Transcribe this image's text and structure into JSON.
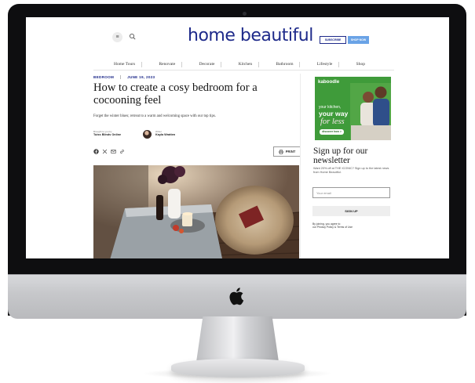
{
  "site": {
    "logo": "home beautiful",
    "menu_icon": "menu-icon",
    "search_icon": "search-icon",
    "subscribe_label": "SUBSCRIBE",
    "shop_label": "SHOP NOW",
    "nav": [
      "Home Tours",
      "Renovate",
      "Decorate",
      "Kitchen",
      "Bathroom",
      "Lifestyle",
      "Shop"
    ]
  },
  "article": {
    "category": "BEDROOM",
    "date": "JUNE 19, 2023",
    "headline": "How to create a cosy bedroom for a cocooning feel",
    "standfirst": "Forget the winter blues; retreat to a warm and welcoming space with our top tips.",
    "brought_by_label": "Brought to you by",
    "brought_by": "Tuiss Blinds Online",
    "writer_label": "Writer",
    "writer": "Kayla Wratten",
    "share_icons": [
      "facebook-icon",
      "x-icon",
      "email-icon",
      "link-icon"
    ],
    "print_label": "PRINT"
  },
  "ad": {
    "brand": "kaboodle",
    "line1": "your kitchen,",
    "line2": "your way",
    "line3": "for less",
    "cta": "discover how >"
  },
  "newsletter": {
    "title": "Sign up for our newsletter",
    "description": "Want 20% off at THE ICONIC? Sign up to the latest news from Home Beautiful.",
    "email_placeholder": "Your email",
    "button_label": "SIGN UP",
    "terms_prefix": "By joining, you agree to",
    "terms_link": "our Privacy Policy & Terms of Use"
  },
  "colors": {
    "brand_blue": "#1e2a8a",
    "shop_blue": "#6aa3e6",
    "ad_green": "#3f9b3a"
  }
}
